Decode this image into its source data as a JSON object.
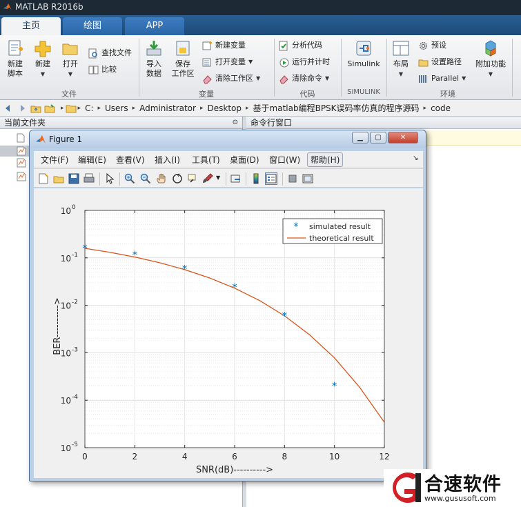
{
  "app": {
    "title": "MATLAB R2016b"
  },
  "tabs": [
    {
      "label": "主页"
    },
    {
      "label": "绘图"
    },
    {
      "label": "APP"
    }
  ],
  "ribbon": {
    "file": {
      "new_script": "新建\n脚本",
      "new": "新建",
      "open": "打开",
      "find_files": "查找文件",
      "compare": "比较",
      "label": "文件"
    },
    "variable": {
      "import_data": "导入\n数据",
      "save_workspace": "保存\n工作区",
      "new_variable": "新建变量",
      "open_variable": "打开变量",
      "clear_workspace": "清除工作区",
      "label": "变量"
    },
    "code": {
      "analyze_code": "分析代码",
      "run_and_time": "运行并计时",
      "clear_commands": "清除命令",
      "label": "代码"
    },
    "simulink": {
      "simulink": "Simulink",
      "label": "SIMULINK"
    },
    "environment": {
      "layout": "布局",
      "preferences": "预设",
      "set_path": "设置路径",
      "parallel": "Parallel",
      "addons": "附加功能",
      "label": "环境"
    }
  },
  "address": {
    "crumbs": [
      "C:",
      "Users",
      "Administrator",
      "Desktop",
      "基于matlab编程BPSK误码率仿真的程序源码",
      "code"
    ]
  },
  "panels": {
    "current_folder": "当前文件夹",
    "command_window": "命令行窗口"
  },
  "figure": {
    "title": "Figure 1",
    "menu": [
      "文件(F)",
      "编辑(E)",
      "查看(V)",
      "插入(I)",
      "工具(T)",
      "桌面(D)",
      "窗口(W)",
      "帮助(H)"
    ]
  },
  "chart_data": {
    "type": "line",
    "xlabel": "SNR(dB)---------->",
    "ylabel": "BER---------->",
    "xlim": [
      0,
      12
    ],
    "ylim": [
      1e-05,
      1
    ],
    "yscale": "log",
    "grid": true,
    "xticks": [
      0,
      2,
      4,
      6,
      8,
      10,
      12
    ],
    "xtick_labels": [
      "0",
      "2",
      "4",
      "6",
      "8",
      "10",
      "12"
    ],
    "yticks": [
      1e-05,
      0.0001,
      0.001,
      0.01,
      0.1,
      1
    ],
    "ytick_labels": [
      {
        "base": "10",
        "exp": "-5"
      },
      {
        "base": "10",
        "exp": "-4"
      },
      {
        "base": "10",
        "exp": "-3"
      },
      {
        "base": "10",
        "exp": "-2"
      },
      {
        "base": "10",
        "exp": "-1"
      },
      {
        "base": "10",
        "exp": "0"
      }
    ],
    "legend_position": "top-right",
    "series": [
      {
        "name": "simulated result",
        "style": "markers",
        "marker": "*",
        "color": "#0072bd",
        "x": [
          0,
          2,
          4,
          6,
          8,
          10
        ],
        "y": [
          0.16,
          0.115,
          0.058,
          0.024,
          0.006,
          0.0002
        ]
      },
      {
        "name": "theoretical result",
        "style": "line",
        "color": "#d95319",
        "x": [
          0,
          1,
          2,
          3,
          4,
          5,
          6,
          7,
          8,
          9,
          10,
          11,
          12
        ],
        "y": [
          0.1587,
          0.1309,
          0.104,
          0.0789,
          0.0565,
          0.0377,
          0.023,
          0.0126,
          0.006,
          0.0024,
          0.00078,
          0.00019,
          3.43e-05
        ]
      }
    ]
  },
  "watermark": {
    "text": "合速软件",
    "url": "www.gususoft.com"
  },
  "colors": {
    "tab_active": "#f2f3f5",
    "title_bar": "#1d2a36",
    "simulated": "#0072bd",
    "theoretical": "#d95319"
  }
}
